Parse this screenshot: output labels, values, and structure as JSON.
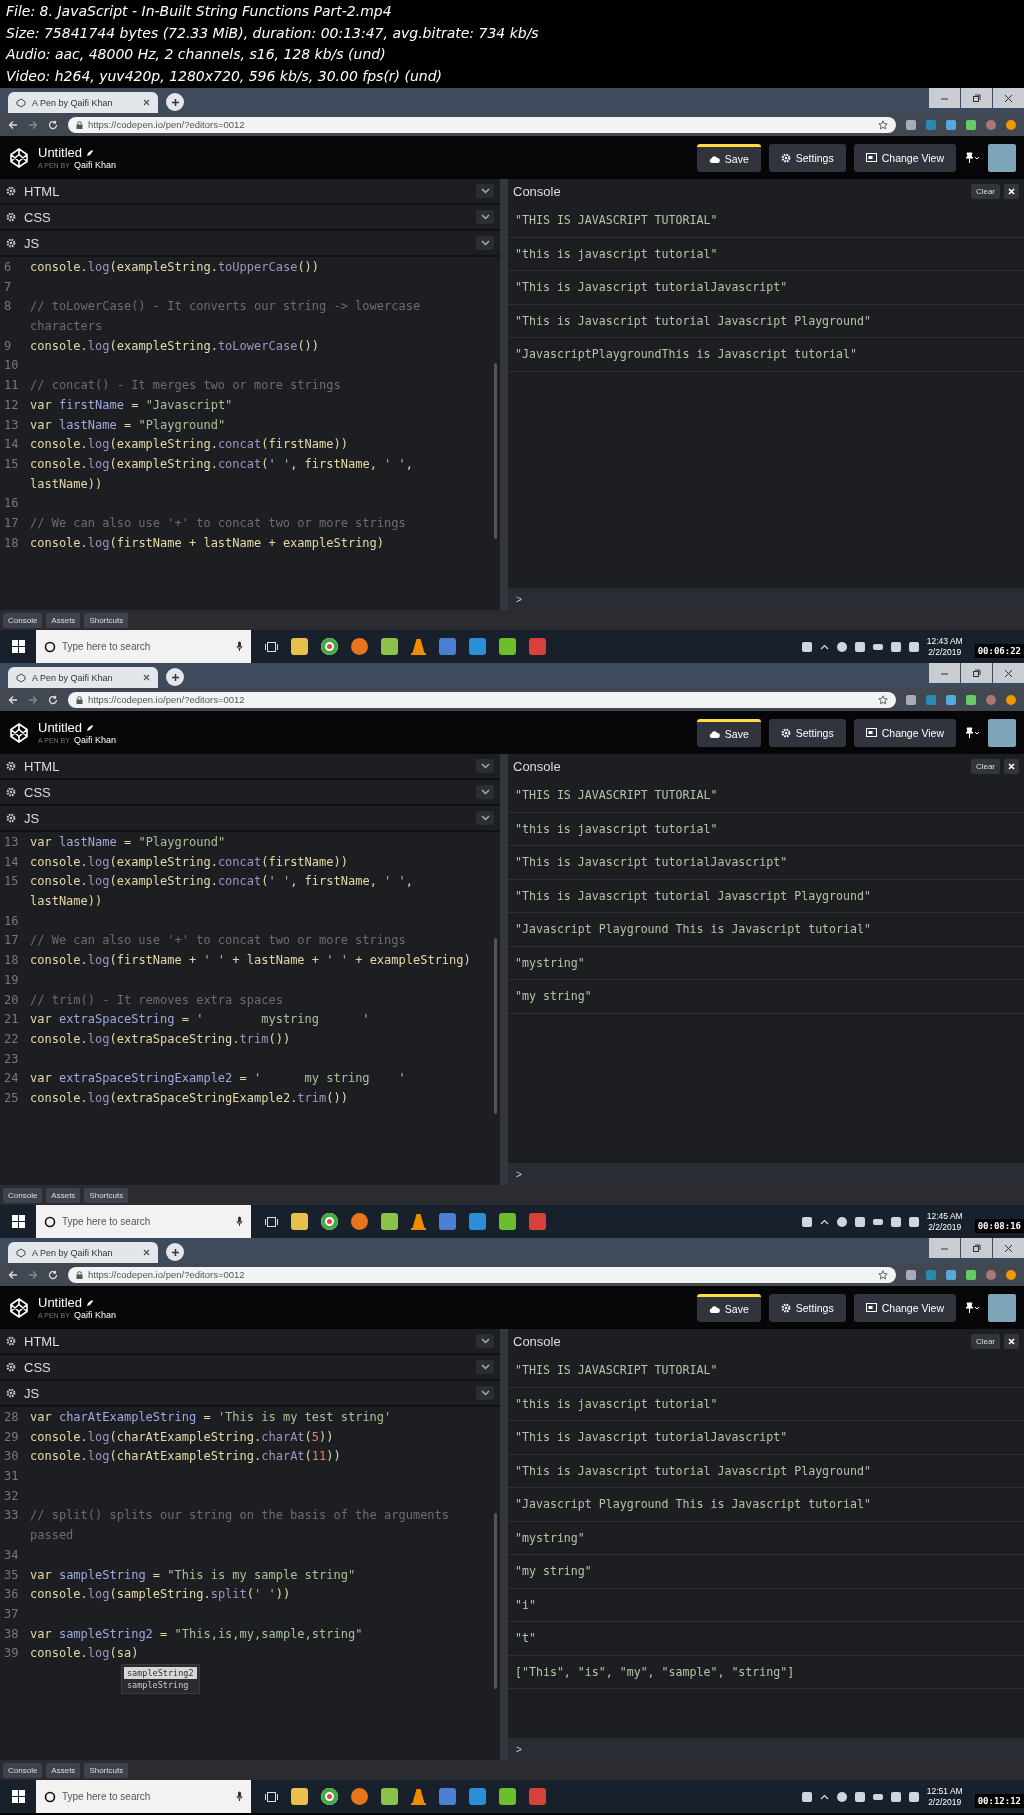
{
  "file_info": [
    "File: 8. JavaScript - In-Built String Functions Part-2.mp4",
    "Size: 75841744 bytes (72.33 MiB), duration: 00:13:47, avg.bitrate: 734 kb/s",
    "Audio: aac, 48000 Hz, 2 channels, s16, 128 kb/s (und)",
    "Video: h264, yuv420p, 1280x720, 596 kb/s, 30.00 fps(r) (und)"
  ],
  "frames": [
    {
      "browser": {
        "tab_title": "A Pen by Qaifi Khan",
        "url": "https://codepen.io/pen/?editors=0012"
      },
      "pen": {
        "title": "Untitled",
        "byline_prefix": "A PEN BY",
        "author": "Qaifi Khan"
      },
      "toolbar": [
        {
          "label": "Save",
          "kind": "save"
        },
        {
          "label": "Settings",
          "kind": "settings"
        },
        {
          "label": "Change View",
          "kind": "view"
        }
      ],
      "panels": [
        "HTML",
        "CSS",
        "JS"
      ],
      "code": [
        {
          "number": "6",
          "kind": "code",
          "text": "console.log(exampleString.toUpperCase())"
        },
        {
          "number": "7"
        },
        {
          "number": "8",
          "kind": "comment",
          "text": "// toLowerCase() - It converts our string -> lowercase"
        },
        {
          "kind": "comment",
          "text": "characters"
        },
        {
          "number": "9",
          "kind": "code",
          "text": "console.log(exampleString.toLowerCase())"
        },
        {
          "number": "10"
        },
        {
          "number": "11",
          "kind": "comment",
          "text": "// concat() - It merges two or more strings"
        },
        {
          "number": "12",
          "kind": "code",
          "text": "var firstName = \"Javascript\""
        },
        {
          "number": "13",
          "kind": "code",
          "text": "var lastName = \"Playground\""
        },
        {
          "number": "14",
          "kind": "code",
          "text": "console.log(exampleString.concat(firstName))"
        },
        {
          "number": "15",
          "kind": "code",
          "text": "console.log(exampleString.concat(' ', firstName, ' ',"
        },
        {
          "kind": "code",
          "text": "lastName))"
        },
        {
          "number": "16"
        },
        {
          "number": "17",
          "kind": "comment",
          "text": "// We can also use '+' to concat two or more strings"
        },
        {
          "number": "18",
          "kind": "code",
          "text": "console.log(firstName + lastName + exampleString)"
        }
      ],
      "console": {
        "title": "Console",
        "clear": "Clear",
        "prompt": ">",
        "output": [
          "\"THIS IS JAVASCRIPT TUTORIAL\"",
          "\"this is javascript tutorial\"",
          "\"This is Javascript tutorialJavascript\"",
          "\"This is Javascript tutorial Javascript Playground\"",
          "\"JavascriptPlaygroundThis is Javascript tutorial\""
        ]
      },
      "bottom_tabs": [
        "Console",
        "Assets",
        "Shortcuts"
      ],
      "taskbar": {
        "search_placeholder": "Type here to search",
        "time": "12:43 AM",
        "date": "2/2/2019"
      },
      "timestamp": "00:06:22"
    },
    {
      "browser": {
        "tab_title": "A Pen by Qaifi Khan",
        "url": "https://codepen.io/pen/?editors=0012"
      },
      "pen": {
        "title": "Untitled",
        "byline_prefix": "A PEN BY",
        "author": "Qaifi Khan"
      },
      "toolbar": [
        {
          "label": "Save",
          "kind": "save"
        },
        {
          "label": "Settings",
          "kind": "settings"
        },
        {
          "label": "Change View",
          "kind": "view"
        }
      ],
      "panels": [
        "HTML",
        "CSS",
        "JS"
      ],
      "code": [
        {
          "number": "13",
          "kind": "code",
          "text": "var lastName = \"Playground\""
        },
        {
          "number": "14",
          "kind": "code",
          "text": "console.log(exampleString.concat(firstName))"
        },
        {
          "number": "15",
          "kind": "code",
          "text": "console.log(exampleString.concat(' ', firstName, ' ',"
        },
        {
          "kind": "code",
          "text": "lastName))"
        },
        {
          "number": "16"
        },
        {
          "number": "17",
          "kind": "comment",
          "text": "// We can also use '+' to concat two or more strings"
        },
        {
          "number": "18",
          "kind": "code",
          "text": "console.log(firstName + ' ' + lastName + ' ' + exampleString)"
        },
        {
          "number": "19"
        },
        {
          "number": "20",
          "kind": "comment",
          "text": "// trim() - It removes extra spaces"
        },
        {
          "number": "21",
          "kind": "code",
          "text": "var extraSpaceString = '        mystring      '"
        },
        {
          "number": "22",
          "kind": "code",
          "text": "console.log(extraSpaceString.trim())"
        },
        {
          "number": "23"
        },
        {
          "number": "24",
          "kind": "code",
          "text": "var extraSpaceStringExample2 = '      my string    '"
        },
        {
          "number": "25",
          "kind": "code",
          "text": "console.log(extraSpaceStringExample2.trim())"
        }
      ],
      "console": {
        "title": "Console",
        "clear": "Clear",
        "prompt": ">",
        "output": [
          "\"THIS IS JAVASCRIPT TUTORIAL\"",
          "\"this is javascript tutorial\"",
          "\"This is Javascript tutorialJavascript\"",
          "\"This is Javascript tutorial Javascript Playground\"",
          "\"Javascript Playground This is Javascript tutorial\"",
          "\"mystring\"",
          "\"my string\""
        ]
      },
      "bottom_tabs": [
        "Console",
        "Assets",
        "Shortcuts"
      ],
      "taskbar": {
        "search_placeholder": "Type here to search",
        "time": "12:45 AM",
        "date": "2/2/2019"
      },
      "timestamp": "00:08:16"
    },
    {
      "browser": {
        "tab_title": "A Pen by Qaifi Khan",
        "url": "https://codepen.io/pen/?editors=0012"
      },
      "pen": {
        "title": "Untitled",
        "byline_prefix": "A PEN BY",
        "author": "Qaifi Khan"
      },
      "toolbar": [
        {
          "label": "Save",
          "kind": "save"
        },
        {
          "label": "Settings",
          "kind": "settings"
        },
        {
          "label": "Change View",
          "kind": "view"
        }
      ],
      "panels": [
        "HTML",
        "CSS",
        "JS"
      ],
      "code": [
        {
          "number": "28",
          "kind": "code",
          "text": "var charAtExampleString = 'This is my test string'"
        },
        {
          "number": "29",
          "kind": "code",
          "text": "console.log(charAtExampleString.charAt(5))"
        },
        {
          "number": "30",
          "kind": "code",
          "text": "console.log(charAtExampleString.charAt(11))"
        },
        {
          "number": "31"
        },
        {
          "number": "32"
        },
        {
          "number": "33",
          "kind": "comment",
          "text": "// split() splits our string on the basis of the arguments"
        },
        {
          "kind": "comment",
          "text": "passed"
        },
        {
          "number": "34"
        },
        {
          "number": "35",
          "kind": "code",
          "text": "var sampleString = \"This is my sample string\""
        },
        {
          "number": "36",
          "kind": "code",
          "text": "console.log(sampleString.split(' '))"
        },
        {
          "number": "37"
        },
        {
          "number": "38",
          "kind": "code",
          "text": "var sampleString2 = \"This,is,my,sample,string\""
        },
        {
          "number": "39",
          "kind": "code",
          "text": "console.log(sa)"
        }
      ],
      "autocomplete": [
        {
          "label": "sampleString2",
          "selected": true
        },
        {
          "label": "sampleString",
          "selected": false
        }
      ],
      "console": {
        "title": "Console",
        "clear": "Clear",
        "prompt": ">",
        "output": [
          "\"THIS IS JAVASCRIPT TUTORIAL\"",
          "\"this is javascript tutorial\"",
          "\"This is Javascript tutorialJavascript\"",
          "\"This is Javascript tutorial Javascript Playground\"",
          "\"Javascript Playground This is Javascript tutorial\"",
          "\"mystring\"",
          "\"my string\"",
          "\"i\"",
          "\"t\"",
          "[\"This\", \"is\", \"my\", \"sample\", \"string\"]"
        ]
      },
      "bottom_tabs": [
        "Console",
        "Assets",
        "Shortcuts"
      ],
      "taskbar": {
        "search_placeholder": "Type here to search",
        "time": "12:51 AM",
        "date": "2/2/2019"
      },
      "timestamp": "00:12:12"
    }
  ]
}
